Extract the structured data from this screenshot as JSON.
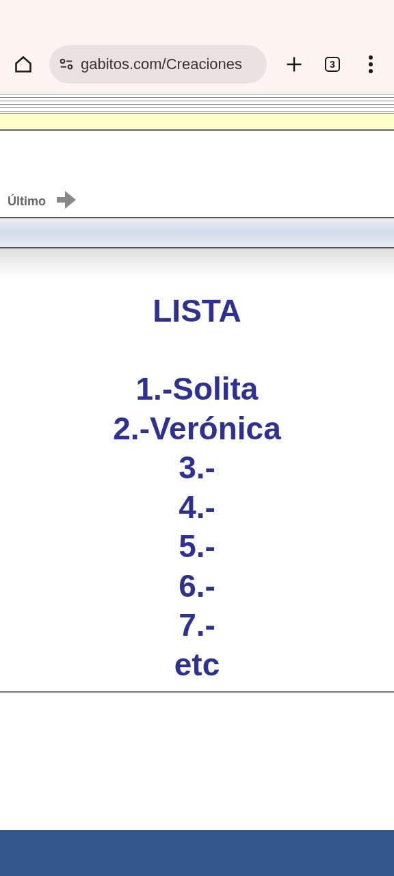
{
  "browser": {
    "url": "gabitos.com/Creaciones",
    "tab_count": "3"
  },
  "nav": {
    "last_link": "Último"
  },
  "content": {
    "title": "LISTA",
    "items": [
      "1.-Solita",
      "2.-Verónica",
      "3.-",
      "4.-",
      "5.-",
      "6.-",
      "7.-",
      "etc"
    ]
  }
}
